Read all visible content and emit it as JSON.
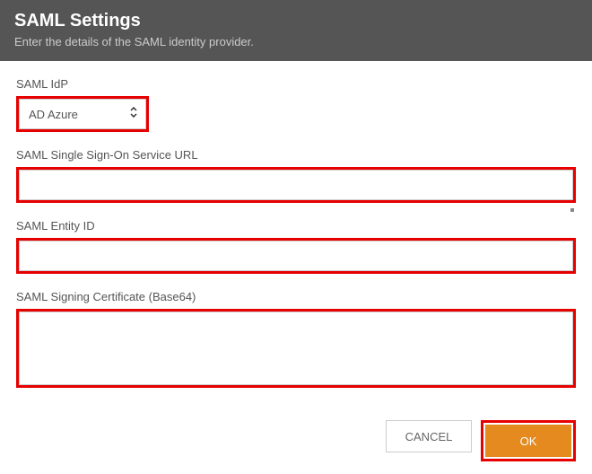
{
  "header": {
    "title": "SAML Settings",
    "subtitle": "Enter the details of the SAML identity provider."
  },
  "fields": {
    "idp": {
      "label": "SAML IdP",
      "value": "AD Azure"
    },
    "sso_url": {
      "label": "SAML Single Sign-On Service URL",
      "value": ""
    },
    "entity_id": {
      "label": "SAML Entity ID",
      "value": ""
    },
    "signing_cert": {
      "label": "SAML Signing Certificate (Base64)",
      "value": ""
    }
  },
  "buttons": {
    "cancel": "CANCEL",
    "ok": "OK"
  }
}
